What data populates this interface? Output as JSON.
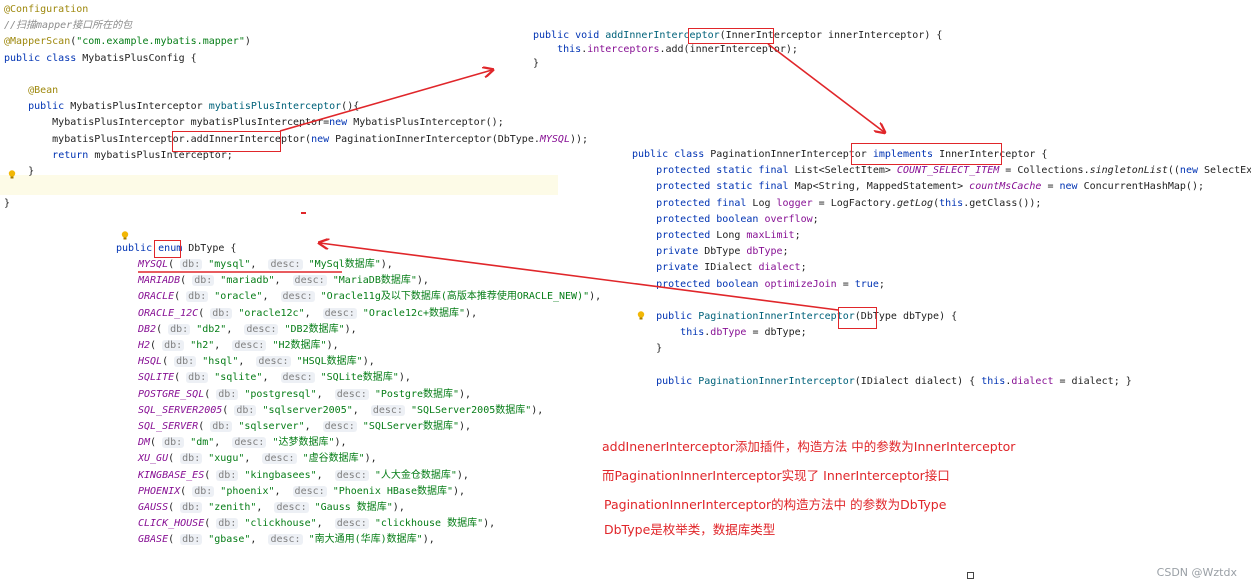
{
  "config_panel": {
    "lines": [
      {
        "parts": [
          {
            "t": "@Configuration",
            "c": "ann"
          }
        ]
      },
      {
        "parts": [
          {
            "t": "//扫描mapper接口所在的包",
            "c": "cm"
          }
        ]
      },
      {
        "parts": [
          {
            "t": "@MapperScan",
            "c": "ann"
          },
          {
            "t": "(",
            "c": ""
          },
          {
            "t": "\"com.example.mybatis.mapper\"",
            "c": "str"
          },
          {
            "t": ")",
            "c": ""
          }
        ]
      },
      {
        "parts": [
          {
            "t": "public class ",
            "c": "kw"
          },
          {
            "t": "MybatisPlusConfig {",
            "c": ""
          }
        ]
      },
      {
        "parts": [
          {
            "t": "",
            "c": ""
          }
        ]
      },
      {
        "parts": [
          {
            "t": "    @Bean",
            "c": "ann"
          }
        ]
      },
      {
        "parts": [
          {
            "t": "    public ",
            "c": "kw"
          },
          {
            "t": "MybatisPlusInterceptor ",
            "c": ""
          },
          {
            "t": "mybatisPlusInterceptor",
            "c": "call"
          },
          {
            "t": "(){",
            "c": ""
          }
        ]
      },
      {
        "parts": [
          {
            "t": "        MybatisPlusInterceptor mybatisPlusInterceptor=",
            "c": ""
          },
          {
            "t": "new ",
            "c": "kw"
          },
          {
            "t": "MybatisPlusInterceptor();",
            "c": ""
          }
        ]
      },
      {
        "parts": [
          {
            "t": "        mybatisPlusInterceptor.",
            "c": ""
          },
          {
            "t": "addInnerInterceptor",
            "c": ""
          },
          {
            "t": "(",
            "c": ""
          },
          {
            "t": "new ",
            "c": "kw"
          },
          {
            "t": "PaginationInnerInterceptor(DbType.",
            "c": ""
          },
          {
            "t": "MYSQL",
            "c": "fld ital"
          },
          {
            "t": "));",
            "c": ""
          }
        ]
      },
      {
        "parts": [
          {
            "t": "        ",
            "c": ""
          },
          {
            "t": "return ",
            "c": "kw"
          },
          {
            "t": "mybatisPlusInterceptor;",
            "c": ""
          }
        ]
      },
      {
        "parts": [
          {
            "t": "    }",
            "c": ""
          }
        ]
      },
      {
        "parts": [
          {
            "t": "",
            "c": ""
          }
        ]
      },
      {
        "parts": [
          {
            "t": "}",
            "c": ""
          }
        ]
      }
    ]
  },
  "add_panel": {
    "lines": [
      {
        "parts": [
          {
            "t": "public void ",
            "c": "kw"
          },
          {
            "t": "addInnerInterceptor",
            "c": "call"
          },
          {
            "t": "(InnerInterceptor innerInterceptor) {",
            "c": ""
          }
        ]
      },
      {
        "parts": [
          {
            "t": "    ",
            "c": ""
          },
          {
            "t": "this",
            "c": "kw"
          },
          {
            "t": ".",
            "c": ""
          },
          {
            "t": "interceptors",
            "c": "fld"
          },
          {
            "t": ".add(innerInterceptor);",
            "c": ""
          }
        ]
      },
      {
        "parts": [
          {
            "t": "}",
            "c": ""
          }
        ]
      }
    ]
  },
  "pagination_panel": {
    "lines": [
      {
        "parts": [
          {
            "t": "public class ",
            "c": "kw"
          },
          {
            "t": "PaginationInnerInterceptor ",
            "c": ""
          },
          {
            "t": "implements ",
            "c": "kw"
          },
          {
            "t": "InnerInterceptor {",
            "c": ""
          }
        ]
      },
      {
        "parts": [
          {
            "t": "    protected static final ",
            "c": "kw"
          },
          {
            "t": "List<SelectItem> ",
            "c": ""
          },
          {
            "t": "COUNT_SELECT_ITEM",
            "c": "fld ital"
          },
          {
            "t": " = Collections.",
            "c": ""
          },
          {
            "t": "singletonList",
            "c": "ital"
          },
          {
            "t": "((",
            "c": ""
          },
          {
            "t": "new ",
            "c": "kw"
          },
          {
            "t": "SelectExpressi",
            "c": ""
          }
        ]
      },
      {
        "parts": [
          {
            "t": "    protected static final ",
            "c": "kw"
          },
          {
            "t": "Map<String, MappedStatement> ",
            "c": ""
          },
          {
            "t": "countMsCache",
            "c": "fld ital"
          },
          {
            "t": " = ",
            "c": ""
          },
          {
            "t": "new ",
            "c": "kw"
          },
          {
            "t": "ConcurrentHashMap();",
            "c": ""
          }
        ]
      },
      {
        "parts": [
          {
            "t": "    protected final ",
            "c": "kw"
          },
          {
            "t": "Log ",
            "c": ""
          },
          {
            "t": "logger",
            "c": "fld"
          },
          {
            "t": " = LogFactory.",
            "c": ""
          },
          {
            "t": "getLog",
            "c": "ital"
          },
          {
            "t": "(",
            "c": ""
          },
          {
            "t": "this",
            "c": "kw"
          },
          {
            "t": ".getClass());",
            "c": ""
          }
        ]
      },
      {
        "parts": [
          {
            "t": "    protected boolean ",
            "c": "kw"
          },
          {
            "t": "overflow",
            "c": "fld"
          },
          {
            "t": ";",
            "c": ""
          }
        ]
      },
      {
        "parts": [
          {
            "t": "    protected ",
            "c": "kw"
          },
          {
            "t": "Long ",
            "c": ""
          },
          {
            "t": "maxLimit",
            "c": "fld"
          },
          {
            "t": ";",
            "c": ""
          }
        ]
      },
      {
        "parts": [
          {
            "t": "    private ",
            "c": "kw"
          },
          {
            "t": "DbType ",
            "c": ""
          },
          {
            "t": "dbType",
            "c": "fld"
          },
          {
            "t": ";",
            "c": ""
          }
        ]
      },
      {
        "parts": [
          {
            "t": "    private ",
            "c": "kw"
          },
          {
            "t": "IDialect ",
            "c": ""
          },
          {
            "t": "dialect",
            "c": "fld"
          },
          {
            "t": ";",
            "c": ""
          }
        ]
      },
      {
        "parts": [
          {
            "t": "    protected boolean ",
            "c": "kw"
          },
          {
            "t": "optimizeJoin",
            "c": "fld"
          },
          {
            "t": " = ",
            "c": ""
          },
          {
            "t": "true",
            "c": "kw"
          },
          {
            "t": ";",
            "c": ""
          }
        ]
      },
      {
        "parts": [
          {
            "t": "",
            "c": ""
          }
        ]
      },
      {
        "parts": [
          {
            "t": "    public ",
            "c": "kw"
          },
          {
            "t": "PaginationInnerInterceptor",
            "c": "call"
          },
          {
            "t": "(DbType dbType) {",
            "c": ""
          }
        ]
      },
      {
        "parts": [
          {
            "t": "        ",
            "c": ""
          },
          {
            "t": "this",
            "c": "kw"
          },
          {
            "t": ".",
            "c": ""
          },
          {
            "t": "dbType",
            "c": "fld"
          },
          {
            "t": " = dbType;",
            "c": ""
          }
        ]
      },
      {
        "parts": [
          {
            "t": "    }",
            "c": ""
          }
        ]
      },
      {
        "parts": [
          {
            "t": "",
            "c": ""
          }
        ]
      },
      {
        "parts": [
          {
            "t": "    public ",
            "c": "kw"
          },
          {
            "t": "PaginationInnerInterceptor",
            "c": "call"
          },
          {
            "t": "(IDialect dialect) { ",
            "c": ""
          },
          {
            "t": "this",
            "c": "kw"
          },
          {
            "t": ".",
            "c": ""
          },
          {
            "t": "dialect",
            "c": "fld"
          },
          {
            "t": " = dialect; }",
            "c": ""
          }
        ]
      }
    ]
  },
  "enum_panel": {
    "header": [
      {
        "t": "public ",
        "c": "kw"
      },
      {
        "t": "enum",
        "c": "kw"
      },
      {
        "t": " DbType {",
        "c": ""
      }
    ],
    "entries": [
      {
        "name": "MYSQL",
        "db": "\"mysql\"",
        "desc": "\"MySql数据库\""
      },
      {
        "name": "MARIADB",
        "db": "\"mariadb\"",
        "desc": "\"MariaDB数据库\""
      },
      {
        "name": "ORACLE",
        "db": "\"oracle\"",
        "desc": "\"Oracle11g及以下数据库(高版本推荐使用ORACLE_NEW)\""
      },
      {
        "name": "ORACLE_12C",
        "db": "\"oracle12c\"",
        "desc": "\"Oracle12c+数据库\""
      },
      {
        "name": "DB2",
        "db": "\"db2\"",
        "desc": "\"DB2数据库\""
      },
      {
        "name": "H2",
        "db": "\"h2\"",
        "desc": "\"H2数据库\""
      },
      {
        "name": "HSQL",
        "db": "\"hsql\"",
        "desc": "\"HSQL数据库\""
      },
      {
        "name": "SQLITE",
        "db": "\"sqlite\"",
        "desc": "\"SQLite数据库\""
      },
      {
        "name": "POSTGRE_SQL",
        "db": "\"postgresql\"",
        "desc": "\"Postgre数据库\""
      },
      {
        "name": "SQL_SERVER2005",
        "db": "\"sqlserver2005\"",
        "desc": "\"SQLServer2005数据库\""
      },
      {
        "name": "SQL_SERVER",
        "db": "\"sqlserver\"",
        "desc": "\"SQLServer数据库\""
      },
      {
        "name": "DM",
        "db": "\"dm\"",
        "desc": "\"达梦数据库\""
      },
      {
        "name": "XU_GU",
        "db": "\"xugu\"",
        "desc": "\"虚谷数据库\""
      },
      {
        "name": "KINGBASE_ES",
        "db": "\"kingbasees\"",
        "desc": "\"人大金仓数据库\""
      },
      {
        "name": "PHOENIX",
        "db": "\"phoenix\"",
        "desc": "\"Phoenix HBase数据库\""
      },
      {
        "name": "GAUSS",
        "db": "\"zenith\"",
        "desc": "\"Gauss 数据库\""
      },
      {
        "name": "CLICK_HOUSE",
        "db": "\"clickhouse\"",
        "desc": "\"clickhouse 数据库\""
      },
      {
        "name": "GBASE",
        "db": "\"gbase\"",
        "desc": "\"南大通用(华库)数据库\""
      }
    ],
    "hint_db": "db:",
    "hint_desc": "desc:"
  },
  "notes": [
    "addInenerInterceptor添加插件，构造方法 中的参数为InnerInterceptor",
    "而PaginationInnerInterceptor实现了  InnerInterceptor接口",
    "PaginationInnerInterceptor的构造方法中 的参数为DbType",
    "DbType是枚举类，数据库类型"
  ],
  "watermark": "CSDN @Wztdx",
  "colors": {
    "annotation_red": "#e0262a",
    "keyword": "#0033b3",
    "string": "#067d17",
    "field": "#871094",
    "annotation": "#9e880d"
  }
}
